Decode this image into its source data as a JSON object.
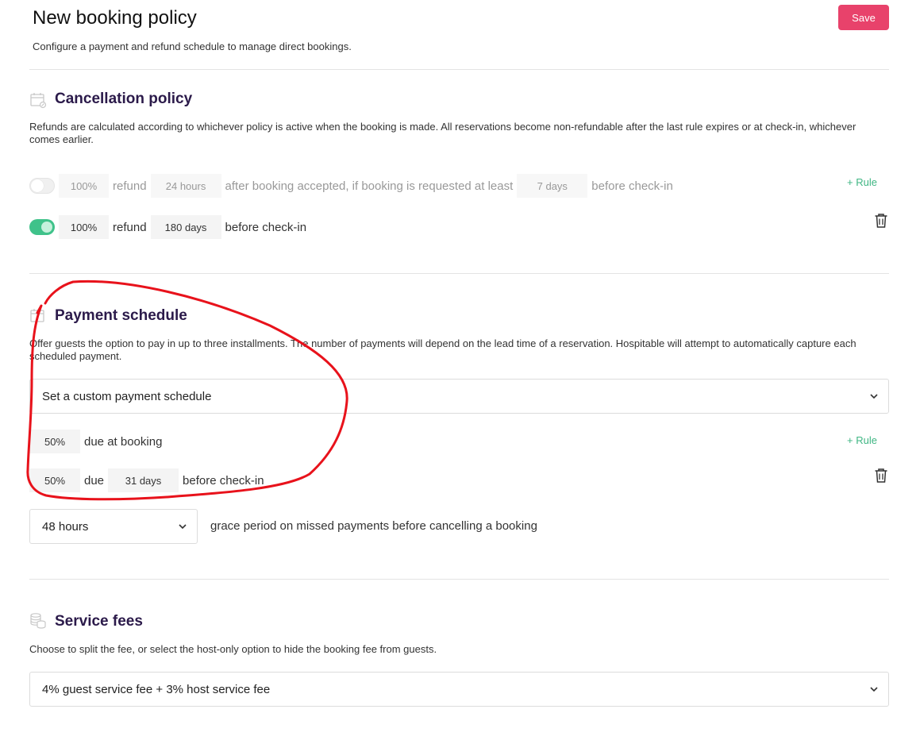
{
  "header": {
    "title": "New booking policy",
    "subtitle": "Configure a payment and refund schedule to manage direct bookings.",
    "save_label": "Save"
  },
  "cancellation": {
    "title": "Cancellation policy",
    "description": "Refunds are calculated according to whichever policy is active when the booking is made. All reservations become non-refundable after the last rule expires or at check-in, whichever comes earlier.",
    "add_rule_label": "+ Rule",
    "rule1": {
      "enabled": false,
      "percent": "100%",
      "refund_text": "refund",
      "duration": "24 hours",
      "middle_text": "after booking accepted, if booking is requested at least",
      "lead": "7 days",
      "end_text": "before check-in"
    },
    "rule2": {
      "enabled": true,
      "percent": "100%",
      "refund_text": "refund",
      "duration": "180 days",
      "end_text": "before check-in"
    }
  },
  "payment": {
    "title": "Payment schedule",
    "description": "Offer guests the option to pay in up to three installments. The number of payments will depend on the lead time of a reservation. Hospitable will attempt to automatically capture each scheduled payment.",
    "schedule_select": "Set a custom payment schedule",
    "add_rule_label": "+ Rule",
    "rule1": {
      "percent": "50%",
      "text": "due at booking"
    },
    "rule2": {
      "percent": "50%",
      "due_text": "due",
      "days": "31 days",
      "end_text": "before check-in"
    },
    "grace_select": "48 hours",
    "grace_text": "grace period on missed payments before cancelling a booking"
  },
  "service_fees": {
    "title": "Service fees",
    "description": "Choose to split the fee, or select the host-only option to hide the booking fee from guests.",
    "fee_select": "4% guest service fee + 3% host service fee"
  },
  "colors": {
    "accent": "#e8426b",
    "toggle_on": "#3fc28a",
    "add_rule": "#3fb683",
    "title": "#2b1a4a",
    "annotation": "#e8121b"
  }
}
